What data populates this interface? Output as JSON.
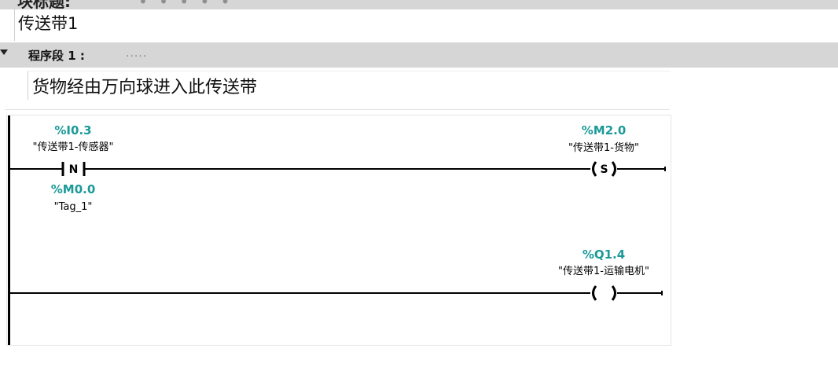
{
  "block": {
    "title_cut": "块标题:",
    "title_dots": "• • • • •",
    "comment": "传送带1"
  },
  "network": {
    "title": "程序段 1 :",
    "placeholder": ".....",
    "comment": "货物经由万向球进入此传送带"
  },
  "rung1": {
    "contact": {
      "address": "%I0.3",
      "symbol": "\"传送带1-传感器\"",
      "type_letter": "N",
      "edge_address": "%M0.0",
      "edge_symbol": "\"Tag_1\""
    },
    "coil": {
      "address": "%M2.0",
      "symbol": "\"传送带1-货物\"",
      "type_letter": "S"
    }
  },
  "rung2": {
    "coil": {
      "address": "%Q1.4",
      "symbol": "\"传送带1-运输电机\"",
      "type_letter": ""
    }
  }
}
